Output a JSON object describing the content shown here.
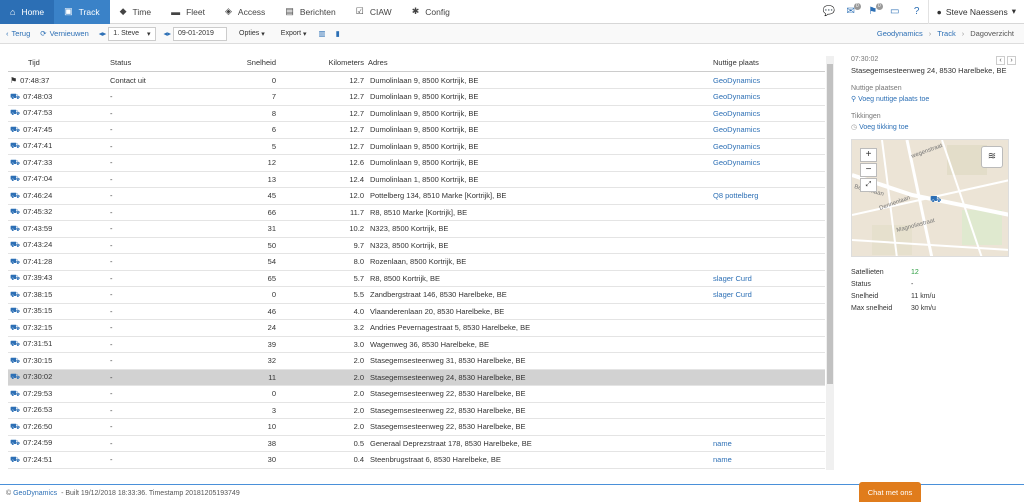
{
  "nav": {
    "tabs": [
      {
        "label": "Home",
        "icon": "home-icon",
        "glyph": "⌂",
        "active": true
      },
      {
        "label": "Track",
        "icon": "map-icon",
        "glyph": "▣",
        "active": true
      },
      {
        "label": "Time",
        "icon": "tag-icon",
        "glyph": "◆",
        "active": false
      },
      {
        "label": "Fleet",
        "icon": "truck-icon",
        "glyph": "▬",
        "active": false
      },
      {
        "label": "Access",
        "icon": "shield-icon",
        "glyph": "◈",
        "active": false
      },
      {
        "label": "Berichten",
        "icon": "note-icon",
        "glyph": "▤",
        "active": false
      },
      {
        "label": "CIAW",
        "icon": "check-icon",
        "glyph": "☑",
        "active": false
      },
      {
        "label": "Config",
        "icon": "gear-icon",
        "glyph": "✱",
        "active": false
      }
    ],
    "badges": [
      "",
      "0",
      "0"
    ],
    "user": "Steve Naessens"
  },
  "toolbar": {
    "back": "Terug",
    "refresh": "Vernieuwen",
    "driver": "1. Steve",
    "date": "09-01-2019",
    "options": "Opties",
    "export": "Export"
  },
  "breadcrumb": {
    "a": "Geodynamics",
    "b": "Track",
    "c": "Dagoverzicht"
  },
  "table": {
    "headers": {
      "time": "Tijd",
      "status": "Status",
      "speed": "Snelheid",
      "km": "Kilometers",
      "address": "Adres",
      "poi": "Nuttige plaats"
    },
    "rows": [
      {
        "time": "07:48:37",
        "status": "Contact uit",
        "speed": "0",
        "km": "12.7",
        "address": "Dumolinlaan 9, 8500 Kortrijk, BE",
        "poi": "GeoDynamics",
        "icon": "flag-icon"
      },
      {
        "time": "07:48:03",
        "status": "-",
        "speed": "7",
        "km": "12.7",
        "address": "Dumolinlaan 9, 8500 Kortrijk, BE",
        "poi": "GeoDynamics",
        "icon": "car-icon"
      },
      {
        "time": "07:47:53",
        "status": "-",
        "speed": "8",
        "km": "12.7",
        "address": "Dumolinlaan 9, 8500 Kortrijk, BE",
        "poi": "GeoDynamics",
        "icon": "car-icon"
      },
      {
        "time": "07:47:45",
        "status": "-",
        "speed": "6",
        "km": "12.7",
        "address": "Dumolinlaan 9, 8500 Kortrijk, BE",
        "poi": "GeoDynamics",
        "icon": "car-icon"
      },
      {
        "time": "07:47:41",
        "status": "-",
        "speed": "5",
        "km": "12.7",
        "address": "Dumolinlaan 9, 8500 Kortrijk, BE",
        "poi": "GeoDynamics",
        "icon": "car-icon"
      },
      {
        "time": "07:47:33",
        "status": "-",
        "speed": "12",
        "km": "12.6",
        "address": "Dumolinlaan 9, 8500 Kortrijk, BE",
        "poi": "GeoDynamics",
        "icon": "car-icon"
      },
      {
        "time": "07:47:04",
        "status": "-",
        "speed": "13",
        "km": "12.4",
        "address": "Dumolinlaan 1, 8500 Kortrijk, BE",
        "poi": "",
        "icon": "car-icon"
      },
      {
        "time": "07:46:24",
        "status": "-",
        "speed": "45",
        "km": "12.0",
        "address": "Pottelberg 134, 8510 Marke [Kortrijk], BE",
        "poi": "Q8 pottelberg",
        "icon": "car-icon"
      },
      {
        "time": "07:45:32",
        "status": "-",
        "speed": "66",
        "km": "11.7",
        "address": "R8, 8510 Marke [Kortrijk], BE",
        "poi": "",
        "icon": "car-icon"
      },
      {
        "time": "07:43:59",
        "status": "-",
        "speed": "31",
        "km": "10.2",
        "address": "N323, 8500 Kortrijk, BE",
        "poi": "",
        "icon": "car-icon"
      },
      {
        "time": "07:43:24",
        "status": "-",
        "speed": "50",
        "km": "9.7",
        "address": "N323, 8500 Kortrijk, BE",
        "poi": "",
        "icon": "car-icon"
      },
      {
        "time": "07:41:28",
        "status": "-",
        "speed": "54",
        "km": "8.0",
        "address": "Rozenlaan, 8500 Kortrijk, BE",
        "poi": "",
        "icon": "car-icon"
      },
      {
        "time": "07:39:43",
        "status": "-",
        "speed": "65",
        "km": "5.7",
        "address": "R8, 8500 Kortrijk, BE",
        "poi": "slager Curd",
        "icon": "car-icon"
      },
      {
        "time": "07:38:15",
        "status": "-",
        "speed": "0",
        "km": "5.5",
        "address": "Zandbergstraat 146, 8530 Harelbeke, BE",
        "poi": "slager Curd",
        "icon": "car-icon"
      },
      {
        "time": "07:35:15",
        "status": "-",
        "speed": "46",
        "km": "4.0",
        "address": "Vlaanderenlaan 20, 8530 Harelbeke, BE",
        "poi": "",
        "icon": "car-icon"
      },
      {
        "time": "07:32:15",
        "status": "-",
        "speed": "24",
        "km": "3.2",
        "address": "Andries Pevernagestraat 5, 8530 Harelbeke, BE",
        "poi": "",
        "icon": "car-icon"
      },
      {
        "time": "07:31:51",
        "status": "-",
        "speed": "39",
        "km": "3.0",
        "address": "Wagenweg 36, 8530 Harelbeke, BE",
        "poi": "",
        "icon": "car-icon"
      },
      {
        "time": "07:30:15",
        "status": "-",
        "speed": "32",
        "km": "2.0",
        "address": "Stasegemsesteenweg 31, 8530 Harelbeke, BE",
        "poi": "",
        "icon": "car-icon"
      },
      {
        "time": "07:30:02",
        "status": "-",
        "speed": "11",
        "km": "2.0",
        "address": "Stasegemsesteenweg 24, 8530 Harelbeke, BE",
        "poi": "",
        "icon": "car-icon",
        "selected": true
      },
      {
        "time": "07:29:53",
        "status": "-",
        "speed": "0",
        "km": "2.0",
        "address": "Stasegemsesteenweg 22, 8530 Harelbeke, BE",
        "poi": "",
        "icon": "car-icon"
      },
      {
        "time": "07:26:53",
        "status": "-",
        "speed": "3",
        "km": "2.0",
        "address": "Stasegemsesteenweg 22, 8530 Harelbeke, BE",
        "poi": "",
        "icon": "car-icon"
      },
      {
        "time": "07:26:50",
        "status": "-",
        "speed": "10",
        "km": "2.0",
        "address": "Stasegemsesteenweg 22, 8530 Harelbeke, BE",
        "poi": "",
        "icon": "car-icon"
      },
      {
        "time": "07:24:59",
        "status": "-",
        "speed": "38",
        "km": "0.5",
        "address": "Generaal Deprezstraat 178, 8530 Harelbeke, BE",
        "poi": "name",
        "icon": "car-icon"
      },
      {
        "time": "07:24:51",
        "status": "-",
        "speed": "30",
        "km": "0.4",
        "address": "Steenbrugstraat 6, 8530 Harelbeke, BE",
        "poi": "name",
        "icon": "car-icon"
      }
    ]
  },
  "detail": {
    "time": "07:30:02",
    "address": "Stasegemsesteenweg 24, 8530 Harelbeke, BE",
    "poi_label": "Nuttige plaatsen",
    "poi_link": "Voeg nuttige plaats toe",
    "tags_label": "Tikkingen",
    "tags_link": "Voeg tikking toe",
    "map_labels": [
      "Berkenlaan",
      "Dennenlaan",
      "Magnoliastraat",
      "wegenstraat"
    ],
    "stats": [
      {
        "label": "Satellieten",
        "value": "12"
      },
      {
        "label": "Status",
        "value": "-"
      },
      {
        "label": "Snelheid",
        "value": "11 km/u"
      },
      {
        "label": "Max snelheid",
        "value": "30 km/u"
      }
    ]
  },
  "footer": {
    "brand": "GeoDynamics",
    "text": "- Built 19/12/2018 18:33:36. Timestamp 20181205193749"
  },
  "chat": "Chat met ons"
}
